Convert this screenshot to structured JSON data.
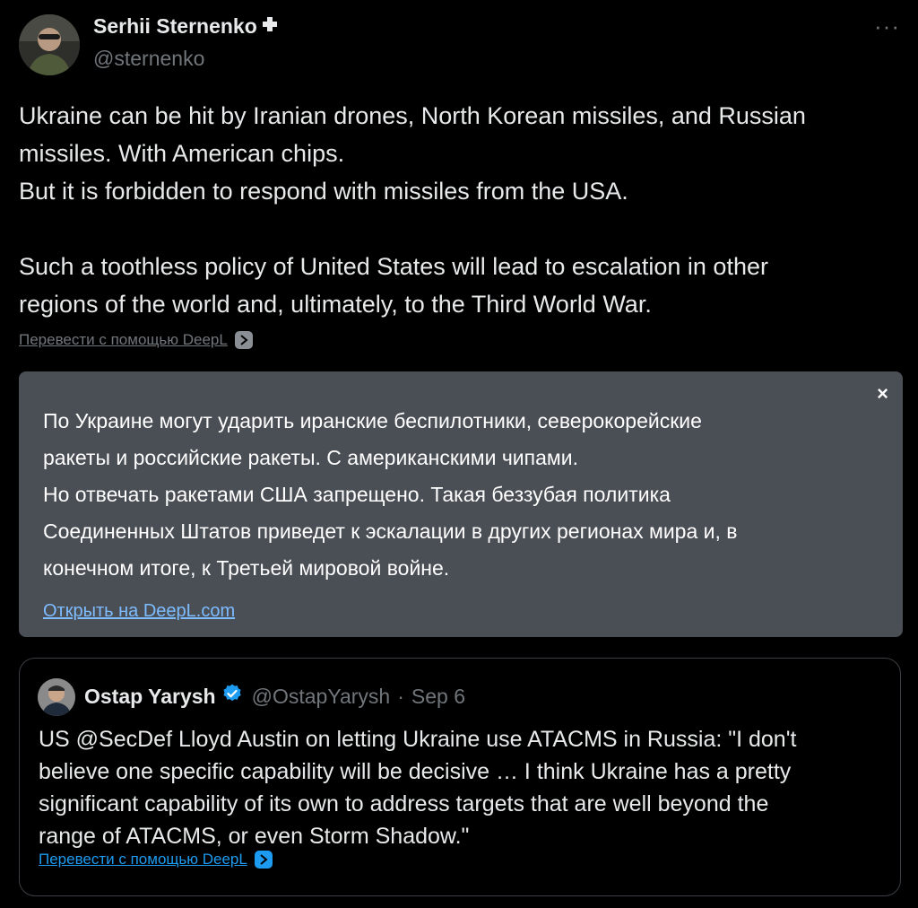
{
  "author": {
    "name": "Serhii Sternenko",
    "handle": "@sternenko",
    "badge_icon": "plus-badge-icon"
  },
  "more_label": "···",
  "tweet": {
    "lines": [
      "Ukraine can be hit by Iranian drones, North Korean missiles, and Russian",
      "missiles. With American chips.",
      "But it is forbidden to respond with missiles from the USA.",
      "Such a toothless policy of United States will lead to escalation in other",
      "regions of the world and, ultimately, to the Third World War."
    ],
    "translate_label": "Перевести с помощью DeepL"
  },
  "translation": {
    "close_label": "×",
    "lines": [
      "По Украине могут ударить иранские беспилотники, северокорейские",
      "ракеты и российские ракеты. С американскими чипами.",
      "Но отвечать ракетами США запрещено. Такая беззубая политика",
      "Соединенных Штатов приведет к эскалации в других регионах мира и, в",
      "конечном итоге, к Третьей мировой войне."
    ],
    "open_label": "Открыть на DeepL.com"
  },
  "quote": {
    "name": "Ostap Yarysh",
    "handle": "@OstapYarysh",
    "separator": "·",
    "date": "Sep 6",
    "verified_icon": "verified-badge-icon",
    "lines": [
      "US @SecDef Lloyd Austin on letting Ukraine use ATACMS in Russia: \"I don't",
      "believe one specific capability will be decisive … I think Ukraine has a pretty",
      "significant capability of its own to address targets that are well beyond the",
      "range of ATACMS, or even Storm Shadow.\""
    ],
    "translate_label": "Перевести с помощью DeepL"
  },
  "colors": {
    "background": "#000000",
    "text": "#e7e9ea",
    "muted": "#71767b",
    "translation_bg": "#4a4e55",
    "link_blue": "#1d9bf0",
    "verified": "#1d9bf0"
  }
}
